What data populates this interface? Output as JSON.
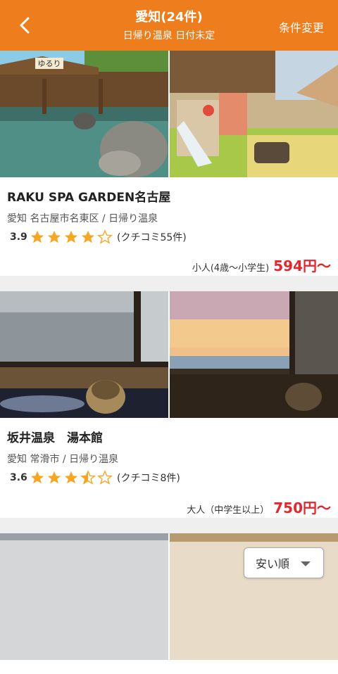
{
  "header": {
    "title": "愛知(24件)",
    "subtitle": "日帰り温泉 日付未定",
    "change_label": "条件変更"
  },
  "listings": [
    {
      "name": "RAKU SPA GARDEN名古屋",
      "location": "愛知 名古屋市名東区 / 日帰り温泉",
      "rating": "3.9",
      "stars": 4,
      "reviews": "(クチコミ55件)",
      "price_label": "小人(4歳〜小学生)",
      "price": "594円〜",
      "sign_text": "ゆるり"
    },
    {
      "name": "坂井温泉　湯本館",
      "location": "愛知 常滑市 / 日帰り温泉",
      "rating": "3.6",
      "stars": 3.5,
      "reviews": "(クチコミ8件)",
      "price_label": "大人（中学生以上）",
      "price": "750円〜"
    }
  ],
  "sort": {
    "label": "安い順"
  },
  "colors": {
    "accent": "#ee7d1d",
    "price": "#e4262d",
    "star": "#f5a623"
  }
}
